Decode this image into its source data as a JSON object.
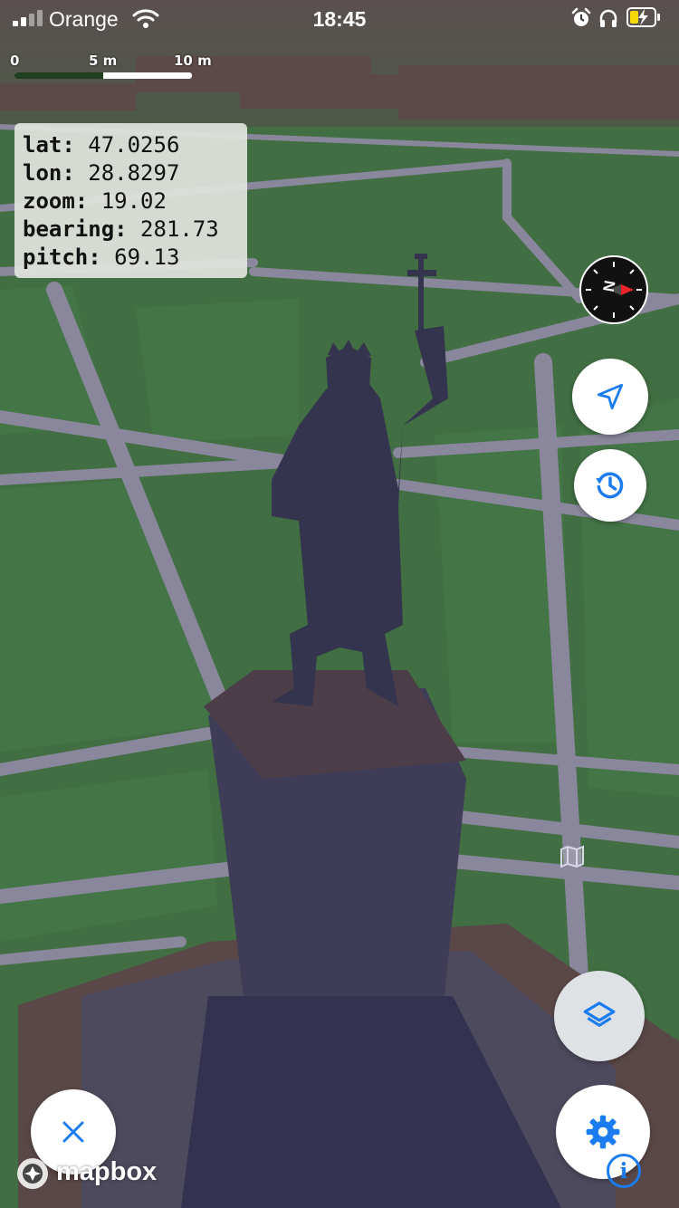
{
  "status_bar": {
    "carrier": "Orange",
    "time": "18:45",
    "icons": [
      "signal-icon",
      "wifi-icon",
      "alarm-icon",
      "headphones-icon",
      "battery-charging-icon"
    ]
  },
  "scale": {
    "labels": [
      "0",
      "5 m",
      "10 m"
    ]
  },
  "info_panel": {
    "lat_label": "lat:",
    "lat_value": "47.0256",
    "lon_label": "lon:",
    "lon_value": "28.8297",
    "zoom_label": "zoom:",
    "zoom_value": "19.02",
    "bearing_label": "bearing:",
    "bearing_value": "281.73",
    "pitch_label": "pitch:",
    "pitch_value": "69.13"
  },
  "compass": {
    "label": "N",
    "icon": "compass-icon"
  },
  "buttons": {
    "locate": "navigation-arrow-icon",
    "history": "history-icon",
    "layers": "layers-icon",
    "close": "close-icon",
    "settings": "gear-icon"
  },
  "attribution": {
    "brand": "mapbox",
    "info": "i"
  },
  "colors": {
    "accent": "#1a7cf0",
    "grass": "#3f6b3f",
    "road": "#8f8aa2",
    "statue": "#3a3a58"
  }
}
